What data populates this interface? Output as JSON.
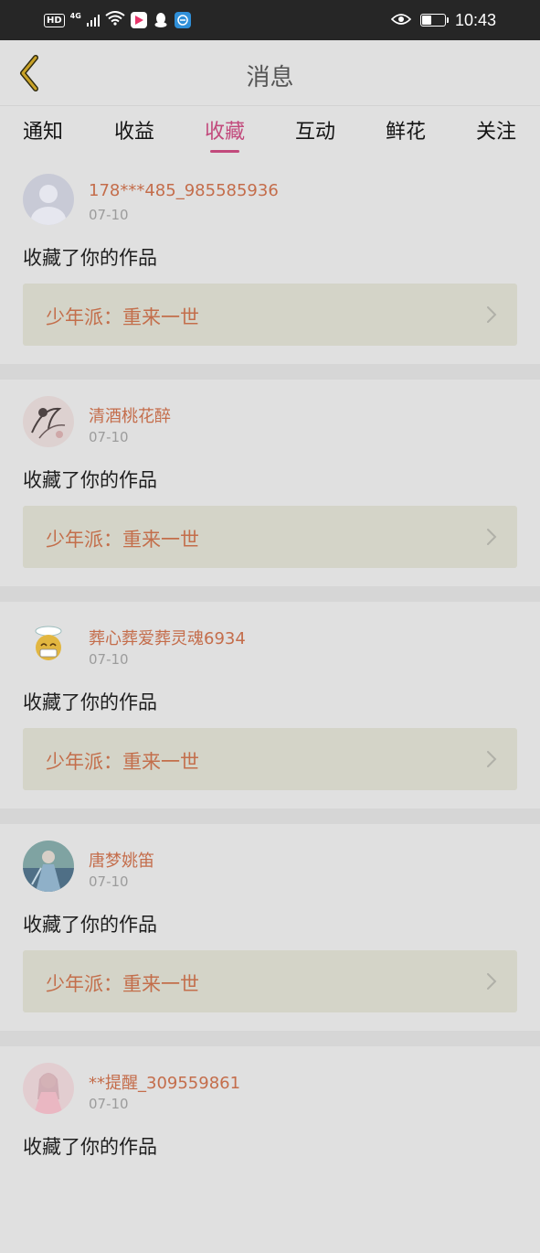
{
  "status_bar": {
    "hd": "HD",
    "network": "4G",
    "time": "10:43",
    "icons": [
      "hd-icon",
      "signal-icon",
      "wifi-icon",
      "play-store-icon",
      "qq-icon",
      "browser-icon",
      "eye-icon",
      "battery-icon"
    ],
    "battery_level": 0.45
  },
  "header": {
    "title": "消息",
    "back_icon": "chevron-left-icon"
  },
  "tabs": [
    {
      "label": "通知"
    },
    {
      "label": "收益"
    },
    {
      "label": "收藏",
      "active": true
    },
    {
      "label": "互动"
    },
    {
      "label": "鲜花"
    },
    {
      "label": "关注"
    }
  ],
  "feed": [
    {
      "user": "178***485_985585936",
      "date": "07-10",
      "action": "收藏了你的作品",
      "work": "少年派：重来一世",
      "avatar": "default-avatar-icon"
    },
    {
      "user": "清酒桃花醉",
      "date": "07-10",
      "action": "收藏了你的作品",
      "work": "少年派：重来一世",
      "avatar": "ink-art-avatar"
    },
    {
      "user": "葬心葬爱葬灵魂6934",
      "date": "07-10",
      "action": "收藏了你的作品",
      "work": "少年派：重来一世",
      "avatar": "emoji-avatar"
    },
    {
      "user": "唐梦姚笛",
      "date": "07-10",
      "action": "收藏了你的作品",
      "work": "少年派：重来一世",
      "avatar": "portrait-avatar"
    },
    {
      "user": "**提醒_309559861",
      "date": "07-10",
      "action": "收藏了你的作品",
      "work": "",
      "avatar": "pink-portrait-avatar"
    }
  ],
  "colors": {
    "accent": "#c24a7c",
    "username": "#c46d4b",
    "work_title": "#c36e4b",
    "status_bar": "#262626"
  }
}
